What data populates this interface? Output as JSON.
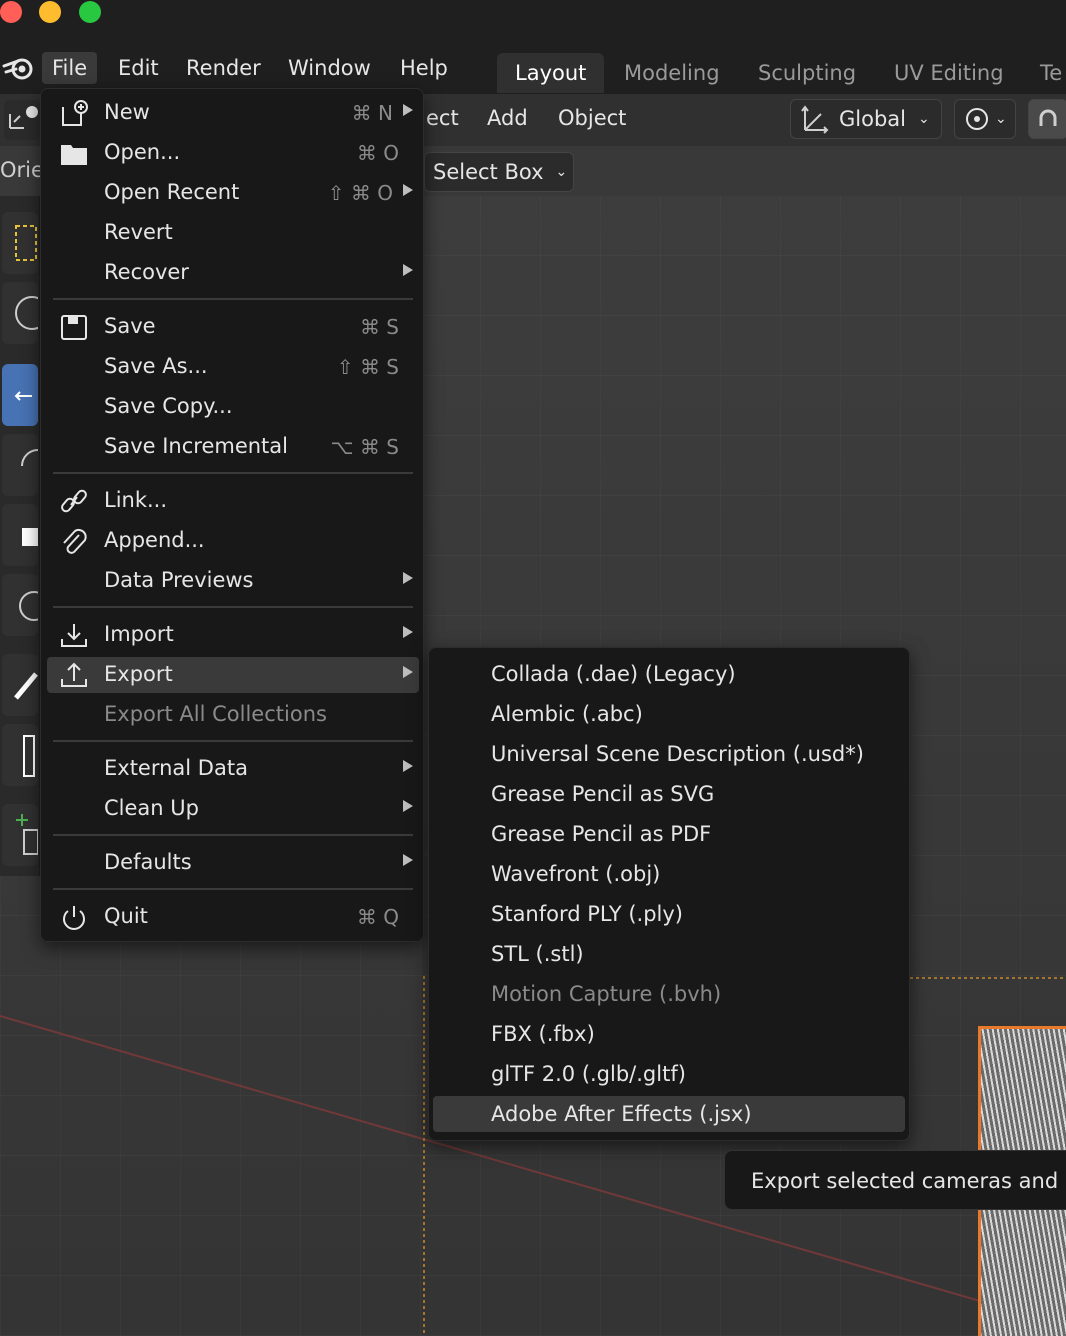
{
  "menubar": {
    "items": [
      "File",
      "Edit",
      "Render",
      "Window",
      "Help"
    ],
    "tabs": [
      {
        "label": "Layout",
        "active": true
      },
      {
        "label": "Modeling",
        "active": false
      },
      {
        "label": "Sculpting",
        "active": false
      },
      {
        "label": "UV Editing",
        "active": false
      },
      {
        "label": "Te",
        "active": false
      }
    ]
  },
  "header": {
    "items": [
      "ect",
      "Add",
      "Object"
    ],
    "transform_orientation": "Global",
    "orientation_label": "Orie",
    "select_mode": "Select Box"
  },
  "file_menu": {
    "items": [
      {
        "label": "New",
        "shortcut": "⌘ N",
        "icon": "new-file-icon",
        "submenu": true
      },
      {
        "label": "Open...",
        "shortcut": "⌘ O",
        "icon": "folder-icon"
      },
      {
        "label": "Open Recent",
        "shortcut": "⇧ ⌘ O",
        "submenu": true
      },
      {
        "label": "Revert"
      },
      {
        "label": "Recover",
        "submenu": true
      },
      {
        "label": "Save",
        "shortcut": "⌘ S",
        "icon": "save-icon"
      },
      {
        "label": "Save As...",
        "shortcut": "⇧ ⌘ S"
      },
      {
        "label": "Save Copy..."
      },
      {
        "label": "Save Incremental",
        "shortcut": "⌥ ⌘ S"
      },
      {
        "label": "Link...",
        "icon": "link-icon"
      },
      {
        "label": "Append...",
        "icon": "paperclip-icon"
      },
      {
        "label": "Data Previews",
        "submenu": true
      },
      {
        "label": "Import",
        "icon": "import-icon",
        "submenu": true
      },
      {
        "label": "Export",
        "icon": "export-icon",
        "submenu": true,
        "highlighted": true
      },
      {
        "label": "Export All Collections",
        "disabled": true
      },
      {
        "label": "External Data",
        "submenu": true
      },
      {
        "label": "Clean Up",
        "submenu": true
      },
      {
        "label": "Defaults",
        "submenu": true
      },
      {
        "label": "Quit",
        "shortcut": "⌘ Q",
        "icon": "power-icon"
      }
    ]
  },
  "export_menu": {
    "items": [
      {
        "label": "Collada (.dae) (Legacy)"
      },
      {
        "label": "Alembic (.abc)"
      },
      {
        "label": "Universal Scene Description (.usd*)"
      },
      {
        "label": "Grease Pencil as SVG"
      },
      {
        "label": "Grease Pencil as PDF"
      },
      {
        "label": "Wavefront (.obj)"
      },
      {
        "label": "Stanford PLY (.ply)"
      },
      {
        "label": "STL (.stl)"
      },
      {
        "label": "Motion Capture (.bvh)",
        "disabled": true
      },
      {
        "label": "FBX (.fbx)"
      },
      {
        "label": "glTF 2.0 (.glb/.gltf)"
      },
      {
        "label": "Adobe After Effects (.jsx)",
        "highlighted": true
      }
    ]
  },
  "tooltip": {
    "text": "Export selected cameras and ob"
  },
  "colors": {
    "traffic_close": "#ff5f57",
    "traffic_min": "#febc2e",
    "traffic_max": "#28c840",
    "accent": "#4772b3",
    "selection_outline": "#e8782a"
  }
}
